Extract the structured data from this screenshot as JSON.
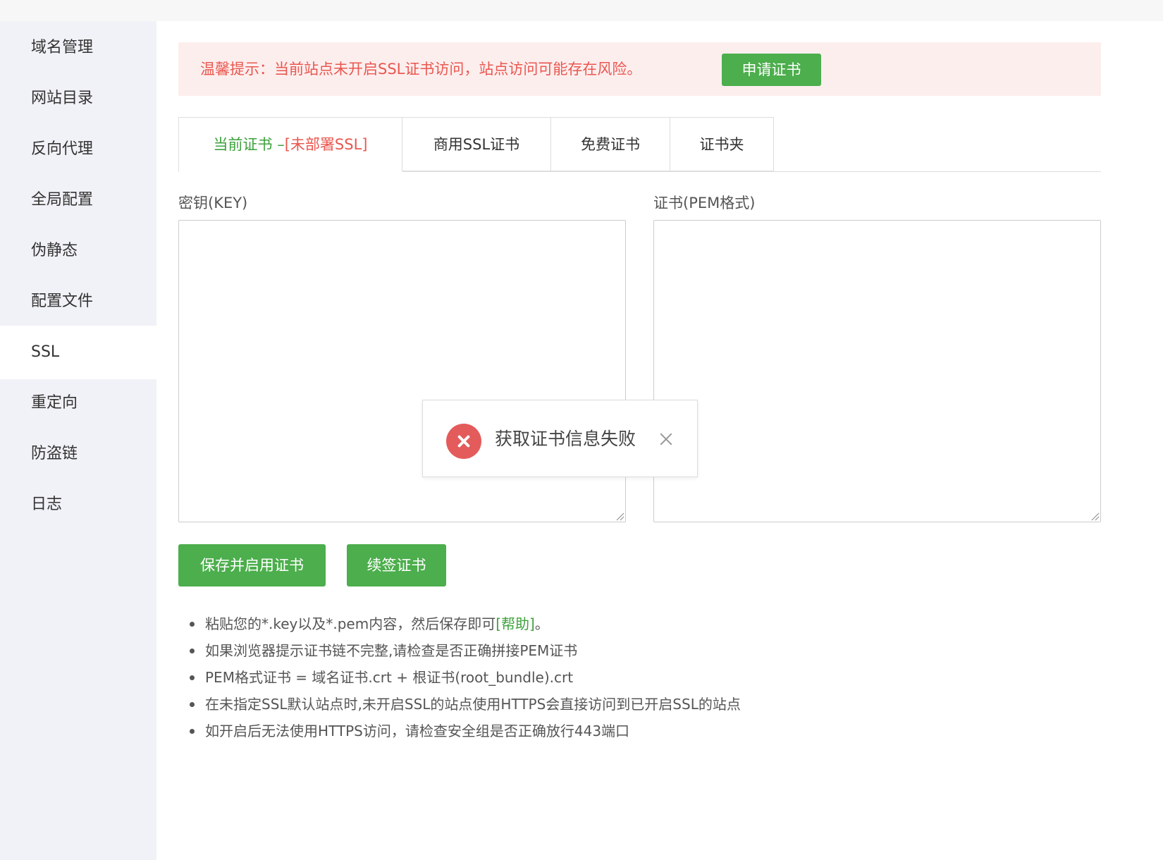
{
  "sidebar": {
    "items": [
      {
        "label": "域名管理"
      },
      {
        "label": "网站目录"
      },
      {
        "label": "反向代理"
      },
      {
        "label": "全局配置"
      },
      {
        "label": "伪静态"
      },
      {
        "label": "配置文件"
      },
      {
        "label": "SSL"
      },
      {
        "label": "重定向"
      },
      {
        "label": "防盗链"
      },
      {
        "label": "日志"
      }
    ],
    "active": "SSL"
  },
  "alert": {
    "text": "温馨提示：当前站点未开启SSL证书访问，站点访问可能存在风险。",
    "button": "申请证书"
  },
  "tabs": [
    {
      "label": "当前证书 –",
      "status": "[未部署SSL]"
    },
    {
      "label": "商用SSL证书"
    },
    {
      "label": "免费证书"
    },
    {
      "label": "证书夹"
    }
  ],
  "form": {
    "key_label": "密钥(KEY)",
    "key_value": "",
    "cert_label": "证书(PEM格式)",
    "cert_value": ""
  },
  "buttons": {
    "save": "保存并启用证书",
    "renew": "续签证书"
  },
  "tips": {
    "first_prefix": "粘贴您的*.key以及*.pem内容，然后保存即可",
    "first_link": "[帮助]",
    "first_suffix": "。",
    "rest": [
      "如果浏览器提示证书链不完整,请检查是否正确拼接PEM证书",
      "PEM格式证书 = 域名证书.crt + 根证书(root_bundle).crt",
      "在未指定SSL默认站点时,未开启SSL的站点使用HTTPS会直接访问到已开启SSL的站点",
      "如开启后无法使用HTTPS访问，请检查安全组是否正确放行443端口"
    ]
  },
  "toast": {
    "icon": "error-circle-icon",
    "message": "获取证书信息失败"
  },
  "colors": {
    "accent_green": "#4cae4c",
    "alert_red": "#e9574f",
    "alert_bg": "#fdeeee",
    "error_icon": "#e45b5b"
  }
}
